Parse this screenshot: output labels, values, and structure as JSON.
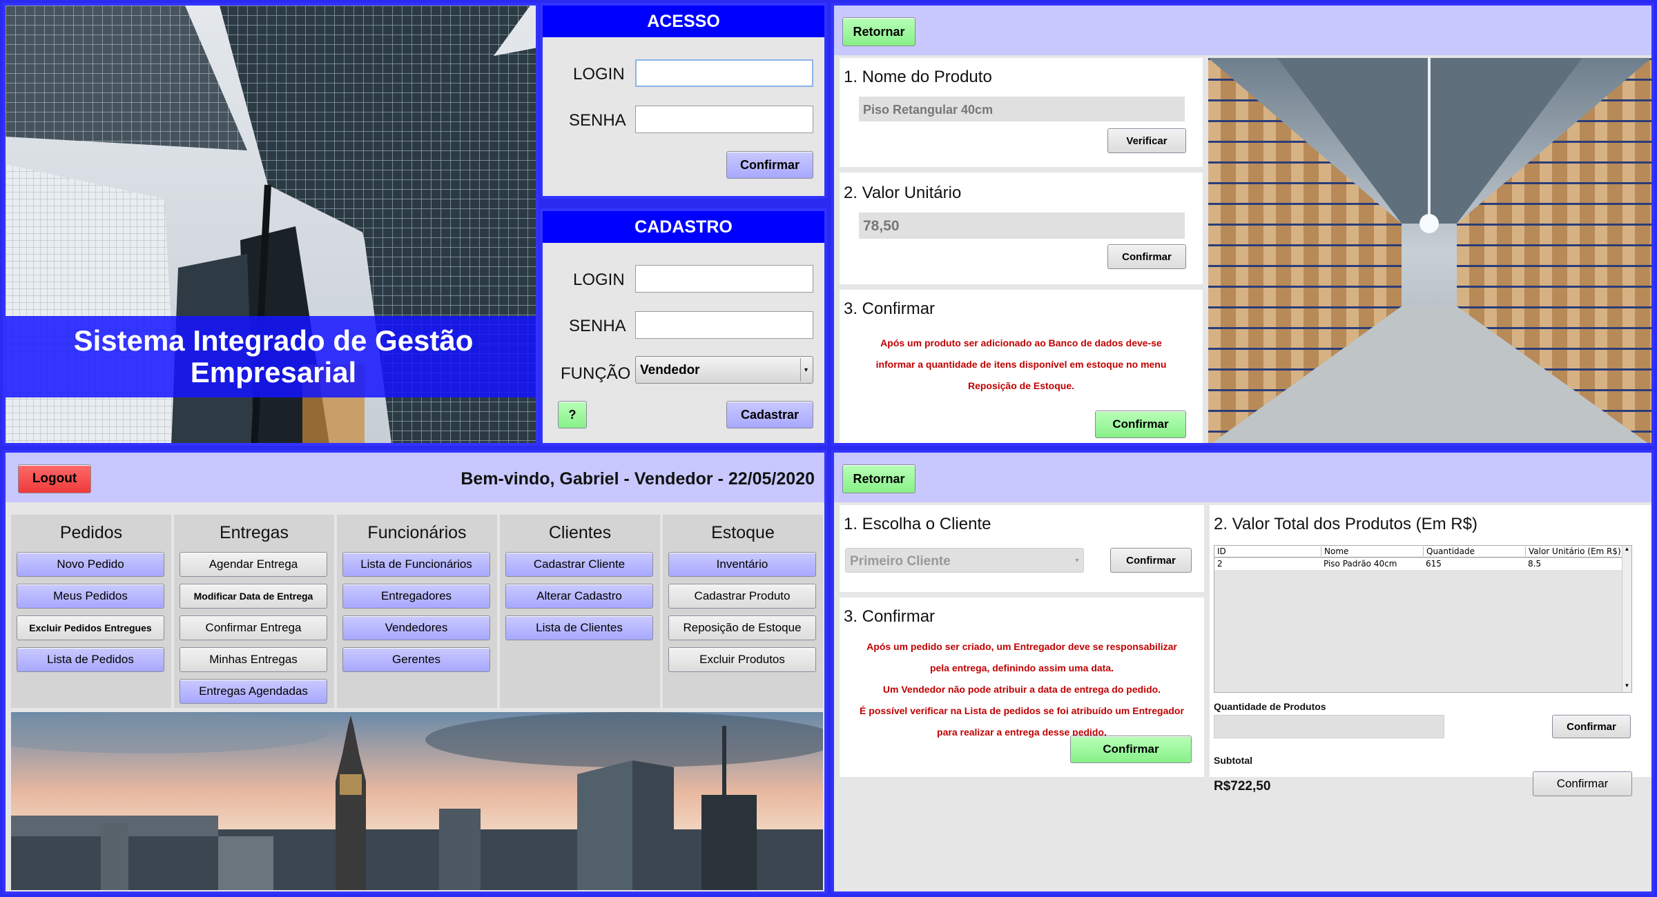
{
  "login_screen": {
    "app_title": "Sistema Integrado de Gestão Empresarial",
    "access": {
      "header": "ACESSO",
      "login_label": "LOGIN",
      "password_label": "SENHA",
      "login_value": "",
      "password_value": "",
      "confirm": "Confirmar"
    },
    "register": {
      "header": "CADASTRO",
      "login_label": "LOGIN",
      "password_label": "SENHA",
      "role_label": "FUNÇÃO",
      "role_value": "Vendedor",
      "help": "?",
      "submit": "Cadastrar"
    }
  },
  "product_screen": {
    "back": "Retornar",
    "step1": {
      "title": "1. Nome do Produto",
      "value": "Piso Retangular 40cm",
      "button": "Verificar"
    },
    "step2": {
      "title": "2. Valor Unitário",
      "value": "78,50",
      "button": "Confirmar"
    },
    "step3": {
      "title": "3. Confirmar",
      "notes": [
        "Após um produto ser adicionado ao Banco de dados deve-se",
        "informar a quantidade de itens disponível em estoque no menu",
        "Reposição de Estoque."
      ],
      "button": "Confirmar"
    }
  },
  "dashboard": {
    "logout": "Logout",
    "welcome": "Bem-vindo, Gabriel - Vendedor - 22/05/2020",
    "columns": [
      {
        "title": "Pedidos",
        "items": [
          "Novo Pedido",
          "Meus Pedidos",
          "Excluir Pedidos Entregues",
          "Lista de Pedidos"
        ]
      },
      {
        "title": "Entregas",
        "items": [
          "Agendar Entrega",
          "Modificar Data de Entrega",
          "Confirmar Entrega",
          "Minhas Entregas",
          "Entregas Agendadas"
        ]
      },
      {
        "title": "Funcionários",
        "items": [
          "Lista de Funcionários",
          "Entregadores",
          "Vendedores",
          "Gerentes"
        ]
      },
      {
        "title": "Clientes",
        "items": [
          "Cadastrar Cliente",
          "Alterar Cadastro",
          "Lista de Clientes"
        ]
      },
      {
        "title": "Estoque",
        "items": [
          "Inventário",
          "Cadastrar Produto",
          "Reposição de Estoque",
          "Excluir Produtos"
        ]
      }
    ]
  },
  "order_screen": {
    "back": "Retornar",
    "step1": {
      "title": "1. Escolha o Cliente",
      "client": "Primeiro Cliente",
      "button": "Confirmar"
    },
    "step2": {
      "title": "2. Valor Total dos Produtos (Em R$)",
      "columns": [
        "ID",
        "Nome",
        "Quantidade",
        "Valor Unitário (Em R$)"
      ],
      "rows": [
        [
          "2",
          "Piso Padrão 40cm",
          "615",
          "8.5"
        ]
      ],
      "qty_label": "Quantidade de Produtos",
      "qty_value": "",
      "qty_button": "Confirmar",
      "subtotal_label": "Subtotal",
      "subtotal_value": "R$722,50",
      "subtotal_button": "Confirmar"
    },
    "step3": {
      "title": "3. Confirmar",
      "notes": [
        "Após um pedido ser criado, um Entregador deve se responsabilizar",
        "pela entrega, definindo assim uma data.",
        "Um Vendedor não pode atribuir a data de entrega do pedido.",
        "É possível verificar na Lista de pedidos se foi atribuído um Entregador",
        "para realizar a entrega desse pedido."
      ],
      "button": "Confirmar"
    }
  },
  "colors": {
    "accent_blue": "#0000ff",
    "button_blue": "#a8a8ff",
    "button_green": "#88f088",
    "button_red": "#ee3b3b",
    "note_red": "#c00000"
  }
}
